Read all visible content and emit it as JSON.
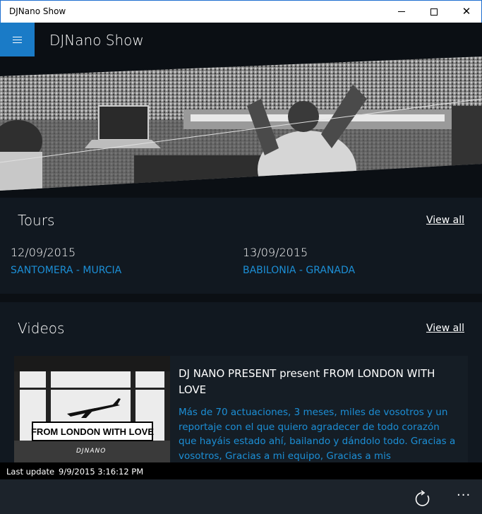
{
  "window": {
    "title": "DJNano Show"
  },
  "appbar": {
    "title": "DJNano Show",
    "menu_icon": "hamburger-icon"
  },
  "tours": {
    "heading": "Tours",
    "view_all": "View all",
    "items": [
      {
        "date": "12/09/2015",
        "place": "SANTOMERA - MURCIA"
      },
      {
        "date": "13/09/2015",
        "place": "BABILONIA - GRANADA"
      }
    ]
  },
  "videos": {
    "heading": "Videos",
    "view_all": "View all",
    "items": [
      {
        "title": "DJ NANO PRESENT present FROM LONDON WITH LOVE",
        "thumb_text": "FROM LONDON WITH LOVE",
        "thumb_logo": "DJNANO",
        "description": "Más de 70 actuaciones, 3 meses, miles de vosotros y un reportaje con el que quiero agradecer de todo corazón que hayáis estado ahí, bailando y dándolo todo. Gracias a vosotros, Gracias a mi equipo, Gracias a mis patrocinadores"
      }
    ]
  },
  "status": {
    "label": "Last update",
    "time": "9/9/2015 3:16:12 PM"
  },
  "commands": {
    "refresh_icon": "refresh-icon",
    "more_icon": "more-icon",
    "more_label": "···"
  },
  "colors": {
    "accent": "#1a7bc7",
    "link": "#1c8fd6",
    "background": "#0b0f14",
    "panel": "#111820"
  }
}
